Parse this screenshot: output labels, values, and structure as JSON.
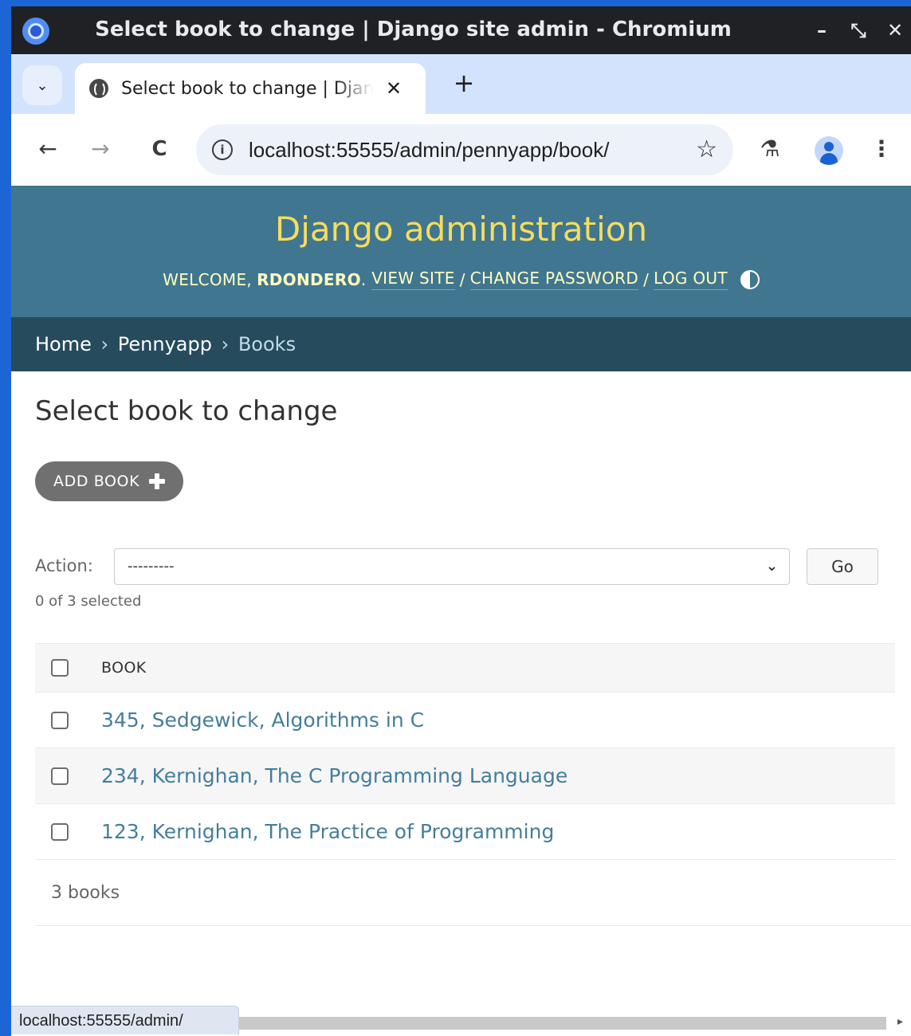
{
  "window": {
    "title": "Select book to change | Django site admin - Chromium",
    "controls": [
      "–",
      "⤡",
      "✕"
    ]
  },
  "browser": {
    "tab_title": "Select book to change | Django site admin",
    "tab_close": "✕",
    "new_tab": "+",
    "tab_menu_icon": "chevron-down-icon",
    "url": "localhost:55555/admin/pennyapp/book/",
    "back": "←",
    "forward": "→",
    "reload": "C",
    "star": "☆",
    "labs": "⚗",
    "menu": "⋮",
    "status_url": "localhost:55555/admin/"
  },
  "header": {
    "branding": "Django administration",
    "welcome": "WELCOME,",
    "username": "RDONDERO",
    "view_site": "VIEW SITE",
    "change_password": "CHANGE PASSWORD",
    "log_out": "LOG OUT",
    "separator": "/"
  },
  "breadcrumbs": {
    "home": "Home",
    "app": "Pennyapp",
    "current": "Books",
    "separator": "›"
  },
  "content": {
    "title": "Select book to change",
    "add_button": "ADD BOOK",
    "action_label": "Action:",
    "action_selected": "---------",
    "go_button": "Go",
    "selected_count": "0 of 3 selected",
    "column_header": "BOOK",
    "books": [
      "345, Sedgewick, Algorithms in C",
      "234, Kernighan, The C Programming Language",
      "123, Kernighan, The Practice of Programming"
    ],
    "paginator": "3 books"
  },
  "colors": {
    "header_bg": "#417690",
    "branding": "#f5dd5d",
    "breadcrumbs_bg": "#264b5d",
    "link": "#447e9b",
    "add_button_bg": "#707070"
  }
}
